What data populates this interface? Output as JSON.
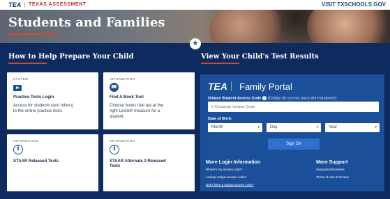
{
  "topbar": {
    "logo": "TEA",
    "program": "TEXAS ASSESSMENT",
    "visit_link": "VISIT TXSCHOOLS.GOV"
  },
  "hero": {
    "title": "Students and Families"
  },
  "left": {
    "heading": "How to Help Prepare Your Child",
    "cards": [
      {
        "tag": "SYSTEM",
        "title": "Practice Tests Login",
        "desc": [
          "Access for students (and others)",
          "to the online practice tests."
        ],
        "icon": "play-icon"
      },
      {
        "tag": "INFORMATION",
        "title": "Find A Book Tool",
        "desc": [
          "Choose books that are at the",
          "right Lexile® measure for a",
          "student."
        ],
        "icon": "book-icon"
      },
      {
        "tag": "INFORMATION",
        "title": "STAAR Released Tests",
        "icon": "info-icon"
      },
      {
        "tag": "INFORMATION",
        "title": "STAAR Alternate 2 Released",
        "title2": "Tests",
        "icon": "info-icon"
      }
    ]
  },
  "right": {
    "heading": "View Your Child's Test Results",
    "portal": {
      "logo": "TEA",
      "title": "Family Portal",
      "code_label": "Unique Student Access Code",
      "code_label_es": "(Código de acceso único del estudiante):",
      "code_placeholder": "6 Character Unique Code",
      "dob_label": "Date of Birth:",
      "month": "Month",
      "day": "Day",
      "year": "Year",
      "signon": "Sign On",
      "login_heading": "More Login Information",
      "login_links": [
        "Where's my access code?",
        "Lookup unique access code?",
        "Don't have a unique access code?"
      ],
      "support_heading": "More Support",
      "support_links": [
        "Supported Browsers",
        "Terms of Use & Privacy"
      ]
    }
  },
  "colors": {
    "navy": "#0d2b5e",
    "portal_blue": "#1b4f9a",
    "accent_red": "#d9472b",
    "button_blue": "#2f6fd0"
  }
}
